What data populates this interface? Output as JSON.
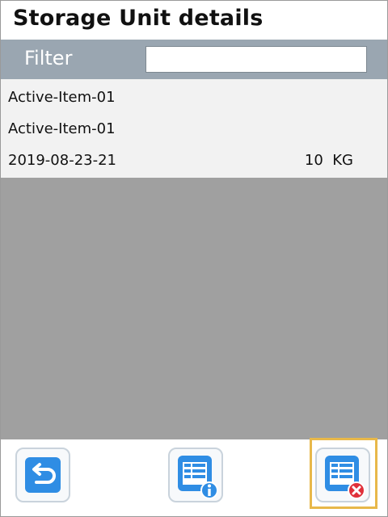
{
  "header": {
    "title": "Storage Unit details"
  },
  "filter": {
    "label": "Filter",
    "value": ""
  },
  "items": [
    {
      "name": "Active-Item-01",
      "description": "Active-Item-01",
      "date": "2019-08-23-21",
      "quantity": "10",
      "unit": "KG"
    }
  ],
  "toolbar": {
    "buttons": [
      {
        "icon": "back-arrow-icon",
        "color": "#2f8de4"
      },
      {
        "icon": "list-info-icon",
        "color": "#2f8de4"
      },
      {
        "icon": "list-delete-icon",
        "color": "#2f8de4",
        "badge_color": "#e0303a",
        "selected": true
      }
    ]
  },
  "colors": {
    "filter_bar": "#9aa6b1",
    "list_background": "#a0a0a0",
    "row_background": "#f2f2f2",
    "selection_highlight": "#e8b84a"
  }
}
